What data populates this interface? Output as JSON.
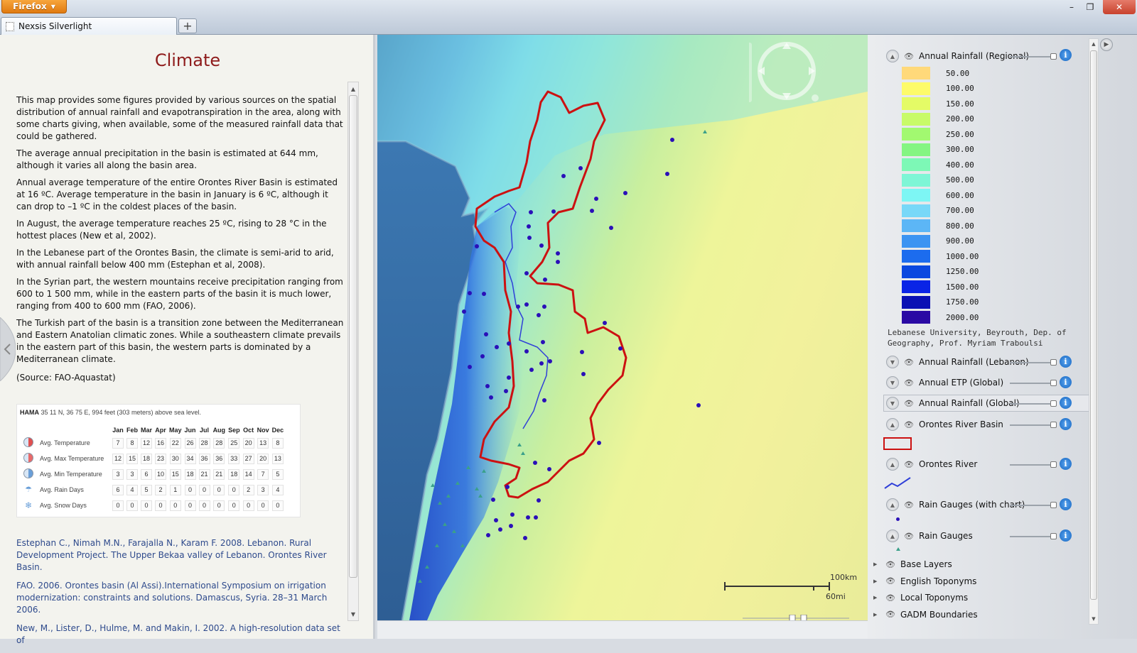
{
  "browser": {
    "app_button": "Firefox",
    "window_controls": {
      "minimize": "–",
      "restore": "❐",
      "close": "✕"
    },
    "tab_title": "Nexsis Silverlight",
    "new_tab": "+"
  },
  "left_panel": {
    "title": "Climate",
    "paragraphs": [
      "This map provides some figures provided by various sources on the spatial distribution of annual rainfall and evapotranspiration in the area, along with some charts giving, when available, some of the measured rainfall data that could be gathered.",
      "The average annual precipitation in the basin is estimated at 644 mm, although it varies all along the basin area.",
      "Annual average temperature of the entire Orontes River Basin is estimated at 16 ºC. Average temperature in the basin in January is 6 ºC, although it can drop to –1 ºC in the coldest places of the basin.",
      "In August, the average temperature reaches 25 ºC, rising to 28 °C in the hottest places (New et al, 2002).",
      "In the Lebanese part of the Orontes Basin, the climate is semi-arid to arid, with annual rainfall below 400 mm (Estephan et al, 2008).",
      "In the Syrian part, the western mountains receive precipitation ranging from 600 to 1 500 mm, while in the eastern parts of the basin it is much lower, ranging from 400 to 600 mm (FAO, 2006).",
      "The Turkish part of the basin is a transition zone between the Mediterranean and Eastern Anatolian climatic zones. While a southeastern climate prevails in the eastern part of this basin, the western parts is dominated by a Mediterranean climate."
    ],
    "source": "(Source: FAO-Aquastat)",
    "climate_table": {
      "station": "HAMA",
      "location": "35 11 N, 36 75 E, 994 feet (303 meters) above sea level.",
      "months": [
        "Jan",
        "Feb",
        "Mar",
        "Apr",
        "May",
        "Jun",
        "Jul",
        "Aug",
        "Sep",
        "Oct",
        "Nov",
        "Dec"
      ],
      "rows": [
        {
          "label": "Avg. Temperature",
          "icon": "thermometer-icon",
          "values": [
            7,
            8,
            12,
            16,
            22,
            26,
            28,
            28,
            25,
            20,
            13,
            8
          ]
        },
        {
          "label": "Avg. Max Temperature",
          "icon": "thermometer-max-icon",
          "values": [
            12,
            15,
            18,
            23,
            30,
            34,
            36,
            36,
            33,
            27,
            20,
            13
          ]
        },
        {
          "label": "Avg. Min Temperature",
          "icon": "thermometer-min-icon",
          "values": [
            3,
            3,
            6,
            10,
            15,
            18,
            21,
            21,
            18,
            14,
            7,
            5
          ]
        },
        {
          "label": "Avg. Rain Days",
          "icon": "rain-icon",
          "values": [
            6,
            4,
            5,
            2,
            1,
            0,
            0,
            0,
            0,
            2,
            3,
            4
          ]
        },
        {
          "label": "Avg. Snow Days",
          "icon": "snow-icon",
          "values": [
            0,
            0,
            0,
            0,
            0,
            0,
            0,
            0,
            0,
            0,
            0,
            0
          ]
        }
      ]
    },
    "references": [
      "Estephan C., Nimah M.N., Farajalla N., Karam F. 2008. Lebanon. Rural Development Project. The Upper Bekaa valley of Lebanon. Orontes River Basin.",
      "FAO. 2006. Orontes basin (Al Assi).International Symposium on irrigation modernization: constraints and solutions. Damascus, Syria. 28–31 March 2006.",
      "New, M., Lister, D., Hulme, M. and Makin, I. 2002. A high-resolution data set of"
    ]
  },
  "map": {
    "scale_km": "100km",
    "scale_mi": "60mi",
    "colors": {
      "basin_outline": "#cc1111",
      "river": "#2f3fd8",
      "rain_gauge_chart": "#2a10b8",
      "rain_gauge": "#3aa08a"
    }
  },
  "layers": {
    "legend_layer": "Annual Rainfall (Regional)",
    "legend": [
      {
        "value": "50.00",
        "color": "#ffd97a"
      },
      {
        "value": "100.00",
        "color": "#fdfb6a"
      },
      {
        "value": "150.00",
        "color": "#e4fb66"
      },
      {
        "value": "200.00",
        "color": "#c8fb68"
      },
      {
        "value": "250.00",
        "color": "#a2f970"
      },
      {
        "value": "300.00",
        "color": "#84f582"
      },
      {
        "value": "400.00",
        "color": "#7df8b6"
      },
      {
        "value": "500.00",
        "color": "#7ef6d6"
      },
      {
        "value": "600.00",
        "color": "#7df6f4"
      },
      {
        "value": "700.00",
        "color": "#78d8f8"
      },
      {
        "value": "800.00",
        "color": "#5cb6f6"
      },
      {
        "value": "900.00",
        "color": "#3c94f2"
      },
      {
        "value": "1000.00",
        "color": "#1c6cee"
      },
      {
        "value": "1250.00",
        "color": "#0b48e0"
      },
      {
        "value": "1500.00",
        "color": "#0a24e6"
      },
      {
        "value": "1750.00",
        "color": "#0a10b4"
      },
      {
        "value": "2000.00",
        "color": "#2a0aa4"
      }
    ],
    "legend_credit": "Lebanese University, Beyrouth, Dep. of Geography, Prof. Myriam Traboulsi",
    "items": [
      {
        "label": "Annual Rainfall (Lebanon)"
      },
      {
        "label": "Annual ETP (Global)"
      },
      {
        "label": "Annual Rainfall (Global)"
      },
      {
        "label": "Orontes River Basin"
      },
      {
        "label": "Orontes River"
      },
      {
        "label": "Rain Gauges (with chart)"
      },
      {
        "label": "Rain Gauges"
      }
    ],
    "groups": [
      {
        "label": "Base Layers"
      },
      {
        "label": "English Toponyms"
      },
      {
        "label": "Local Toponyms"
      },
      {
        "label": "GADM Boundaries"
      }
    ],
    "info": "i"
  }
}
